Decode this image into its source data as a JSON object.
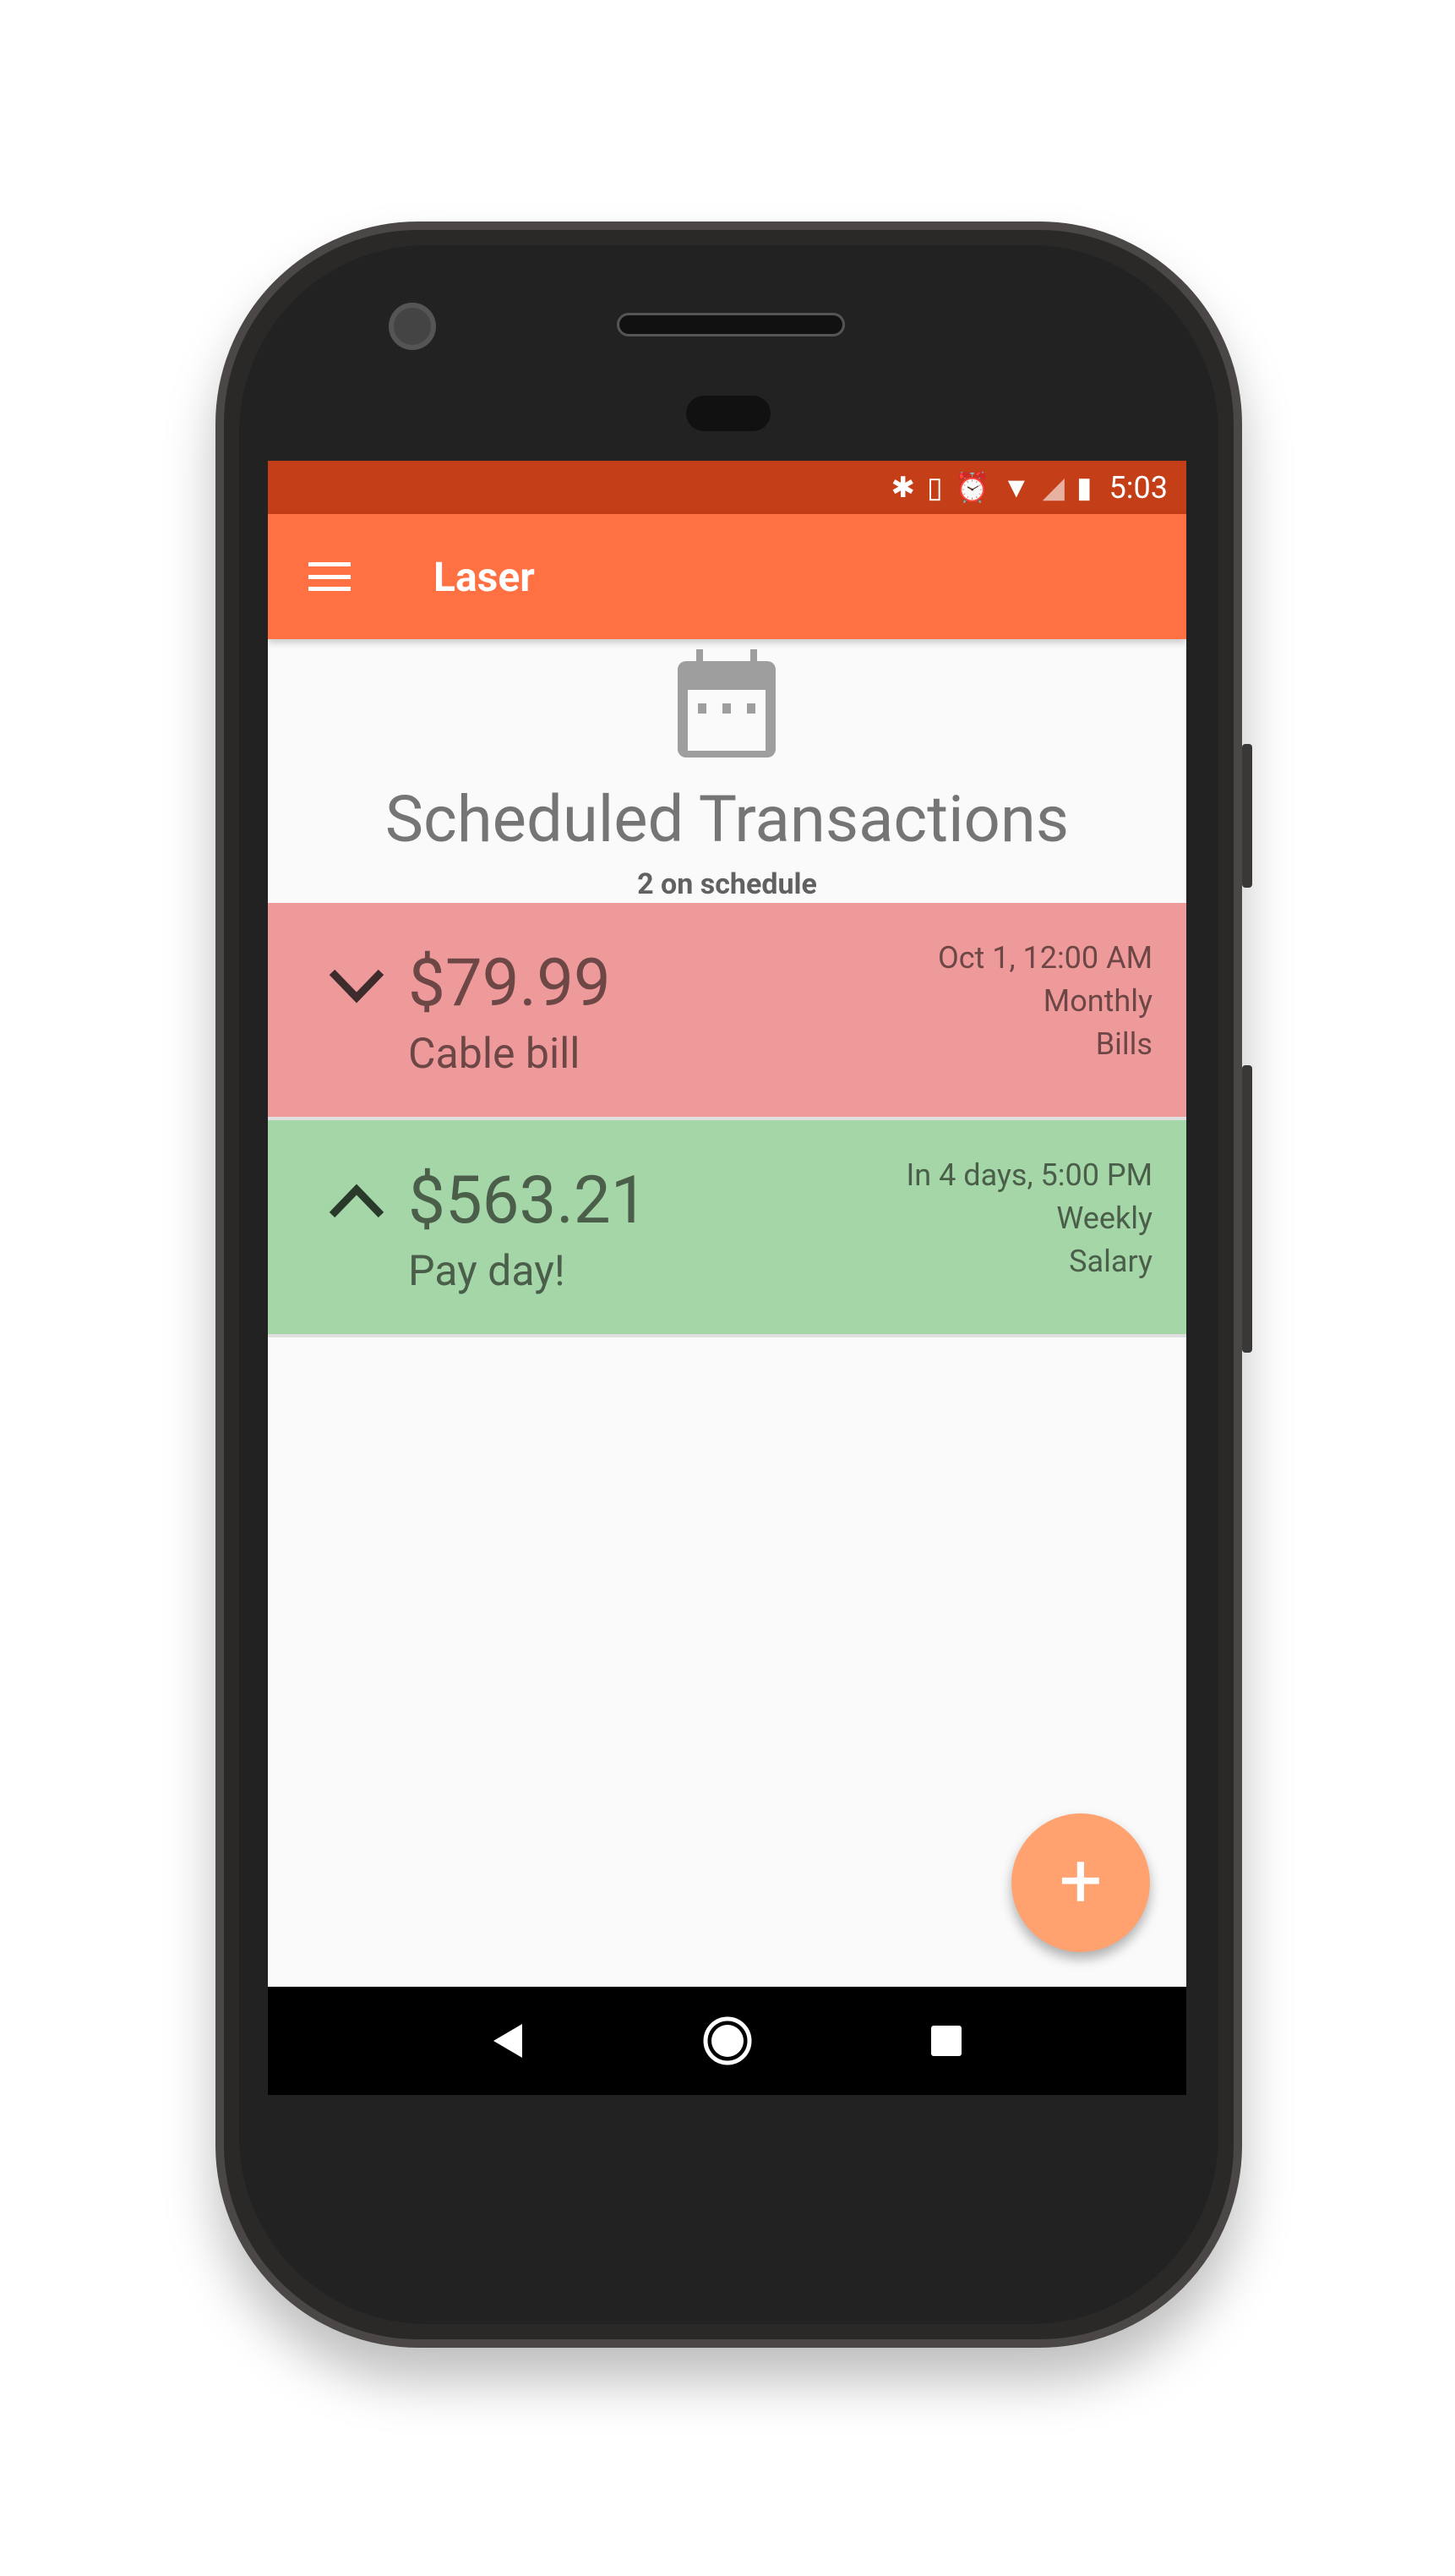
{
  "status_bar": {
    "time": "5:03",
    "icons": [
      "bluetooth-icon",
      "vibrate-icon",
      "alarm-icon",
      "wifi-icon",
      "signal-icon",
      "battery-icon"
    ]
  },
  "app_bar": {
    "title": "Laser",
    "menu_icon": "hamburger-menu-icon"
  },
  "header": {
    "icon": "calendar-icon",
    "title": "Scheduled Transactions",
    "subtitle": "2 on schedule"
  },
  "transactions": [
    {
      "type": "expense",
      "direction_icon": "chevron-down-icon",
      "amount": "$79.99",
      "note": "Cable bill",
      "date": "Oct 1, 12:00 AM",
      "frequency": "Monthly",
      "category": "Bills",
      "color": "#ef9a9a"
    },
    {
      "type": "income",
      "direction_icon": "chevron-up-icon",
      "amount": "$563.21",
      "note": "Pay day!",
      "date": "In 4 days, 5:00 PM",
      "frequency": "Weekly",
      "category": "Salary",
      "color": "#a5d6a7"
    }
  ],
  "fab": {
    "label": "+",
    "icon": "plus-icon"
  },
  "colors": {
    "primary": "#ff7043",
    "primary_dark": "#c43e17",
    "fab": "#ffa270"
  }
}
